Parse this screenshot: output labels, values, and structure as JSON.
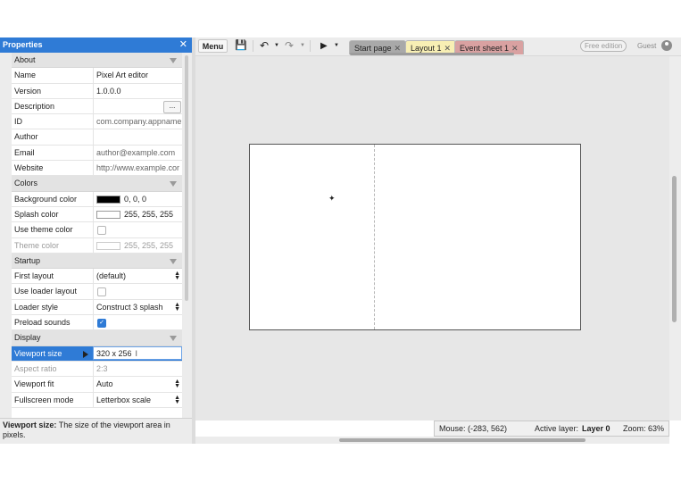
{
  "properties": {
    "title": "Properties",
    "sections": {
      "about": {
        "label": "About",
        "name": {
          "label": "Name",
          "value": "Pixel Art editor"
        },
        "version": {
          "label": "Version",
          "value": "1.0.0.0"
        },
        "description": {
          "label": "Description",
          "value": "",
          "button": "..."
        },
        "id": {
          "label": "ID",
          "value": "com.company.appname"
        },
        "author": {
          "label": "Author",
          "value": ""
        },
        "email": {
          "label": "Email",
          "value": "author@example.com"
        },
        "website": {
          "label": "Website",
          "value": "http://www.example.cor"
        }
      },
      "colors": {
        "label": "Colors",
        "background": {
          "label": "Background color",
          "value": "0, 0, 0",
          "swatch": "#000000"
        },
        "splash": {
          "label": "Splash color",
          "value": "255, 255, 255",
          "swatch": "#ffffff"
        },
        "use_theme": {
          "label": "Use theme color",
          "checked": false
        },
        "theme": {
          "label": "Theme color",
          "value": "255, 255, 255",
          "swatch": "#ffffff"
        }
      },
      "startup": {
        "label": "Startup",
        "first_layout": {
          "label": "First layout",
          "value": "(default)"
        },
        "use_loader": {
          "label": "Use loader layout",
          "checked": false
        },
        "loader_style": {
          "label": "Loader style",
          "value": "Construct 3 splash"
        },
        "preload_sounds": {
          "label": "Preload sounds",
          "checked": true
        }
      },
      "display": {
        "label": "Display",
        "viewport_size": {
          "label": "Viewport size",
          "value": "320 x 256"
        },
        "aspect_ratio": {
          "label": "Aspect ratio",
          "value": "2:3"
        },
        "viewport_fit": {
          "label": "Viewport fit",
          "value": "Auto"
        },
        "fullscreen_mode": {
          "label": "Fullscreen mode",
          "value": "Letterbox scale"
        }
      }
    },
    "help": {
      "title": "Viewport size:",
      "text": "The size of the viewport area in pixels."
    }
  },
  "toolbar": {
    "menu_label": "Menu",
    "tabs": [
      {
        "label": "Start page",
        "color": "#a9a9a9"
      },
      {
        "label": "Layout 1",
        "color": "#f8efb4"
      },
      {
        "label": "Event sheet 1",
        "color": "#d9a1a1"
      }
    ],
    "free_edition": "Free edition",
    "guest": "Guest"
  },
  "status": {
    "mouse": "Mouse: (-283, 562)",
    "active_layer_label": "Active layer:",
    "active_layer_value": "Layer 0",
    "zoom": "Zoom: 63%"
  },
  "icons": [
    "close-icon",
    "save-icon",
    "undo-icon",
    "redo-icon",
    "play-icon",
    "dropdown-arrow-icon",
    "collapse-triangle-icon",
    "user-icon",
    "pin-icon",
    "text-cursor-icon"
  ]
}
